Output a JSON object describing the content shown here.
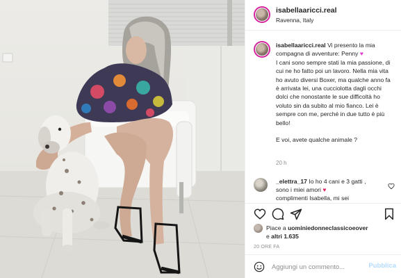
{
  "post": {
    "username": "isabellaaricci.real",
    "location": "Ravenna, Italy",
    "caption": {
      "username": "isabellaaricci.real",
      "text": "Vi presento la mia compagna di avventure: Penny",
      "text_2": "I cani sono sempre stati la mia passione, di cui ne ho fatto poi un lavoro. Nella mia vita ho avuto diversi Boxer, ma qualche anno fa è arrivata lei, una cucciolotta dagli occhi dolci che nonostante le sue difficoltà ho voluto sin da subito al mio fianco. Lei è sempre con me, perché in due tutto è più bello!",
      "text_3": "E voi, avete qualche animale ?",
      "time": "20 h"
    },
    "comment": {
      "username": "_elettra_17",
      "text": "Io ho 4 cani e 3 gatti , sono i miei amori",
      "text_2": "complimenti Isabella, mi sei"
    },
    "likes": {
      "prefix": "Piace a",
      "user": "uominiedonneclassicoeover",
      "connector": "e",
      "others": "altri 1.635"
    },
    "time_ago": "20 ORE FA",
    "add_comment": {
      "placeholder": "Aggiungi un commento...",
      "publish": "Pubblica"
    }
  },
  "icons": {
    "purple_heart": "purple-heart-icon",
    "red_heart": "red-heart-icon",
    "like": "heart-icon",
    "comment": "comment-icon",
    "share": "paper-plane-icon",
    "save": "bookmark-icon",
    "emoji": "smiley-icon"
  },
  "colors": {
    "accent_publish": "#b3dbff",
    "story_ring": "#d6249f",
    "muted": "#8e8e8e",
    "purple_heart": "#e63acb",
    "red_heart": "#e0245e"
  }
}
